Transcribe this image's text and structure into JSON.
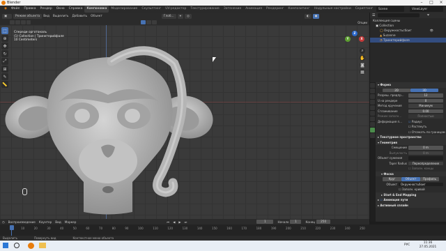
{
  "window": {
    "title": "Blender"
  },
  "menubar": {
    "items": [
      "Файл",
      "Правка",
      "Рендер",
      "Окно",
      "Справка"
    ],
    "workspaces": [
      "Компоновка",
      "Моделирование",
      "Скульптинг",
      "UV-редактор",
      "Текстурирование",
      "Затенение",
      "Анимация",
      "Рендеринг",
      "Композитинг",
      "Нодульные настройки",
      "Скриптинг"
    ],
    "active_workspace": "Компоновка",
    "scene": "Scene",
    "view_layer": "ViewLayer"
  },
  "viewport_header": {
    "mode": "Режим объекта",
    "menus": [
      "Вид",
      "Выделить",
      "Добавить",
      "Объект"
    ],
    "transform": "Глоб...",
    "options": "Опции"
  },
  "viewport_overlay": {
    "line1": "Спереди орготональ",
    "line2": "(1) Collection | Тринктерийфаля",
    "line3": "10 Centimeters"
  },
  "gizmo": {
    "x": "X",
    "y": "Y",
    "z": "Z"
  },
  "outliner": {
    "rows": [
      {
        "label": "Коллекция сцены",
        "indent": 0
      },
      {
        "label": "Collection",
        "indent": 1
      },
      {
        "label": "Окружностьсбоиг",
        "indent": 2
      },
      {
        "label": "Suzanne",
        "indent": 2
      },
      {
        "label": "Тринктерийфаля",
        "indent": 2
      }
    ]
  },
  "properties": {
    "section_shape": "Форма",
    "tab_2d": "2D",
    "tab_3d": "3D",
    "resolution_preview_label": "Разреш. предпр...",
    "resolution_preview_value": "12",
    "resolution_render_label": "U на рендере",
    "resolution_render_value": "0",
    "twist_method_label": "Метод кручения",
    "twist_method_value": "Минимум",
    "smooth_label": "Сглаживание",
    "smooth_value": "0.00",
    "fill_mode_label": "Режим заполн...",
    "fill_mode_value": "Полностью",
    "deform_label": "Деформация п...",
    "check_radius": "Радиус",
    "check_stretch": "Растянуть",
    "check_bounds": "Отсекать по границам",
    "section_texture_space": "Текстурное пространство",
    "section_geometry": "Геометрия",
    "offset_label": "Смещение",
    "offset_value": "0 m",
    "extrude_label": "Выпуклость",
    "extrude_value": "0 m",
    "taper_label": "Объект сужения",
    "taper_radius_label": "Taper Radius",
    "taper_radius_value": "Переопределение",
    "fill_caps_label": "Заполн. концы",
    "section_bevel": "Фаска",
    "bevel_round": "Круг",
    "bevel_object": "Объект",
    "bevel_profile": "Профиль",
    "bevel_object_label": "Объект",
    "bevel_object_value": "Окружностьбоиг",
    "fill_caps2": "Заполн. кривой",
    "section_start_end": "Start & End Mapping",
    "section_path_anim": "Анимация пути",
    "section_active_spline": "Активный сплайн"
  },
  "timeline": {
    "menus": [
      "Воспроизведение",
      "Каунтер",
      "Вид",
      "Маркер"
    ],
    "current_frame": "1",
    "start_label": "Начало",
    "start_value": "1",
    "end_label": "Конец",
    "end_value": "250",
    "ruler": [
      "1",
      "10",
      "20",
      "30",
      "40",
      "50",
      "60",
      "70",
      "80",
      "90",
      "100",
      "110",
      "120",
      "130",
      "140",
      "150",
      "160",
      "170",
      "180",
      "190",
      "200",
      "210",
      "220",
      "230",
      "240",
      "250"
    ]
  },
  "statusbar": {
    "left": "Выделить",
    "mid1": "Повернуть вид",
    "mid2": "Контекстное меню объекта"
  },
  "taskbar": {
    "time": "11:36",
    "date": "27.05.2021",
    "lang": "РУС"
  },
  "colors": {
    "accent": "#4772b3",
    "mesh": "#b8b8b8"
  }
}
